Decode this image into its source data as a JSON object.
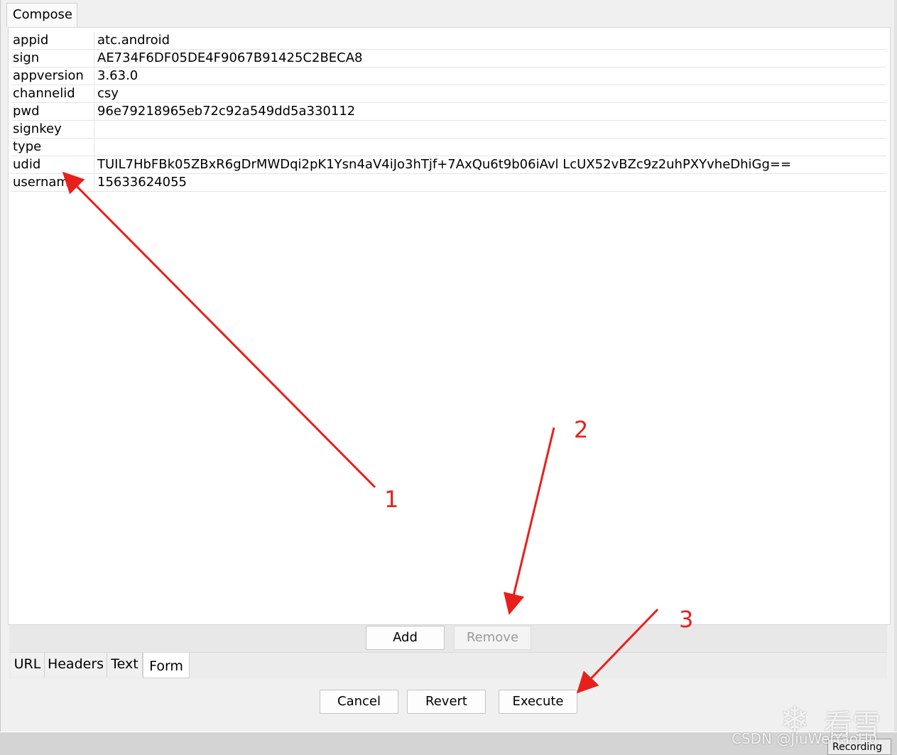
{
  "compose_tab": "Compose",
  "form_rows": [
    {
      "key": " appid",
      "value": "atc.android"
    },
    {
      "key": " sign",
      "value": "AE734F6DF05DE4F9067B91425C2BECA8"
    },
    {
      "key": "appversion",
      "value": "3.63.0"
    },
    {
      "key": "channelid",
      "value": "csy"
    },
    {
      "key": "pwd",
      "value": "96e79218965eb72c92a549dd5a330112"
    },
    {
      "key": "signkey",
      "value": ""
    },
    {
      "key": "type",
      "value": ""
    },
    {
      "key": "udid",
      "value": "TUIL7HbFBk05ZBxR6gDrMWDqi2pK1Ysn4aV4iJo3hTjf+7AxQu6t9b06iAvl LcUX52vBZc9z2uhPXYvheDhiGg=="
    },
    {
      "key": "username",
      "value": "15633624055"
    }
  ],
  "add_button": "Add",
  "remove_button": "Remove",
  "bottom_tabs": [
    "URL",
    "Headers",
    "Text",
    "Form"
  ],
  "active_tab": "Form",
  "cancel_button": "Cancel",
  "revert_button": "Revert",
  "execute_button": "Execute",
  "status_recording": "Recording",
  "annotations": [
    "1",
    "2",
    "3"
  ],
  "annotation_color": "#e8201c",
  "watermark": {
    "text": "CSDN @JiuWeiYaoHu",
    "chinese": "看雪"
  }
}
